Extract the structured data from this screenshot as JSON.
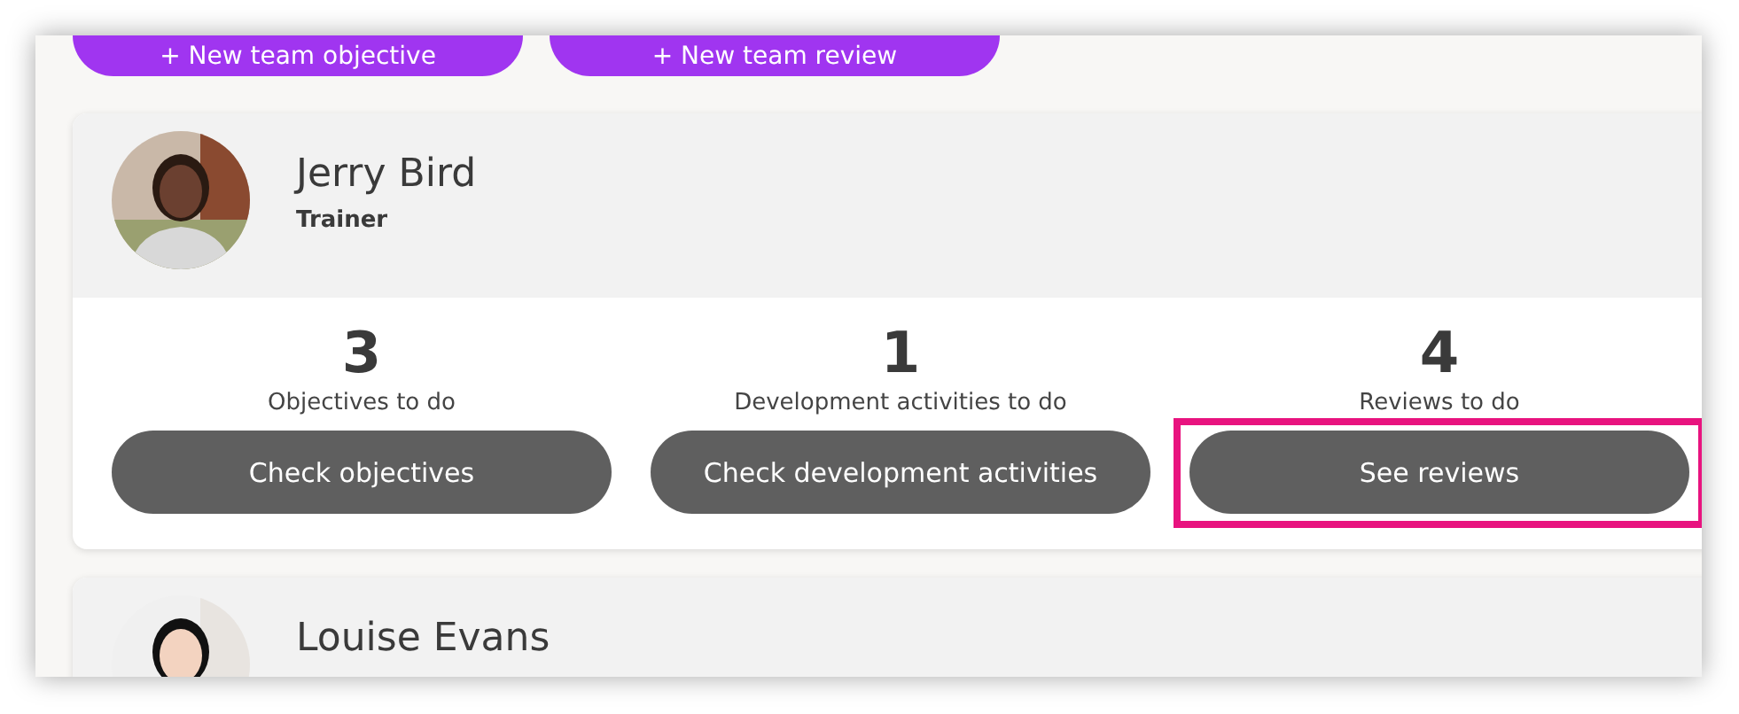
{
  "top_buttons": [
    {
      "label": "+ New team objective"
    },
    {
      "label": "+ New team review"
    }
  ],
  "members": [
    {
      "name": "Jerry Bird",
      "role": "Trainer",
      "stats": [
        {
          "count": "3",
          "label": "Objectives to do",
          "action": "Check objectives",
          "highlighted": false
        },
        {
          "count": "1",
          "label": "Development activities to do",
          "action": "Check development activities",
          "highlighted": false
        },
        {
          "count": "4",
          "label": "Reviews to do",
          "action": "See reviews",
          "highlighted": true
        }
      ]
    },
    {
      "name": "Louise Evans"
    }
  ]
}
